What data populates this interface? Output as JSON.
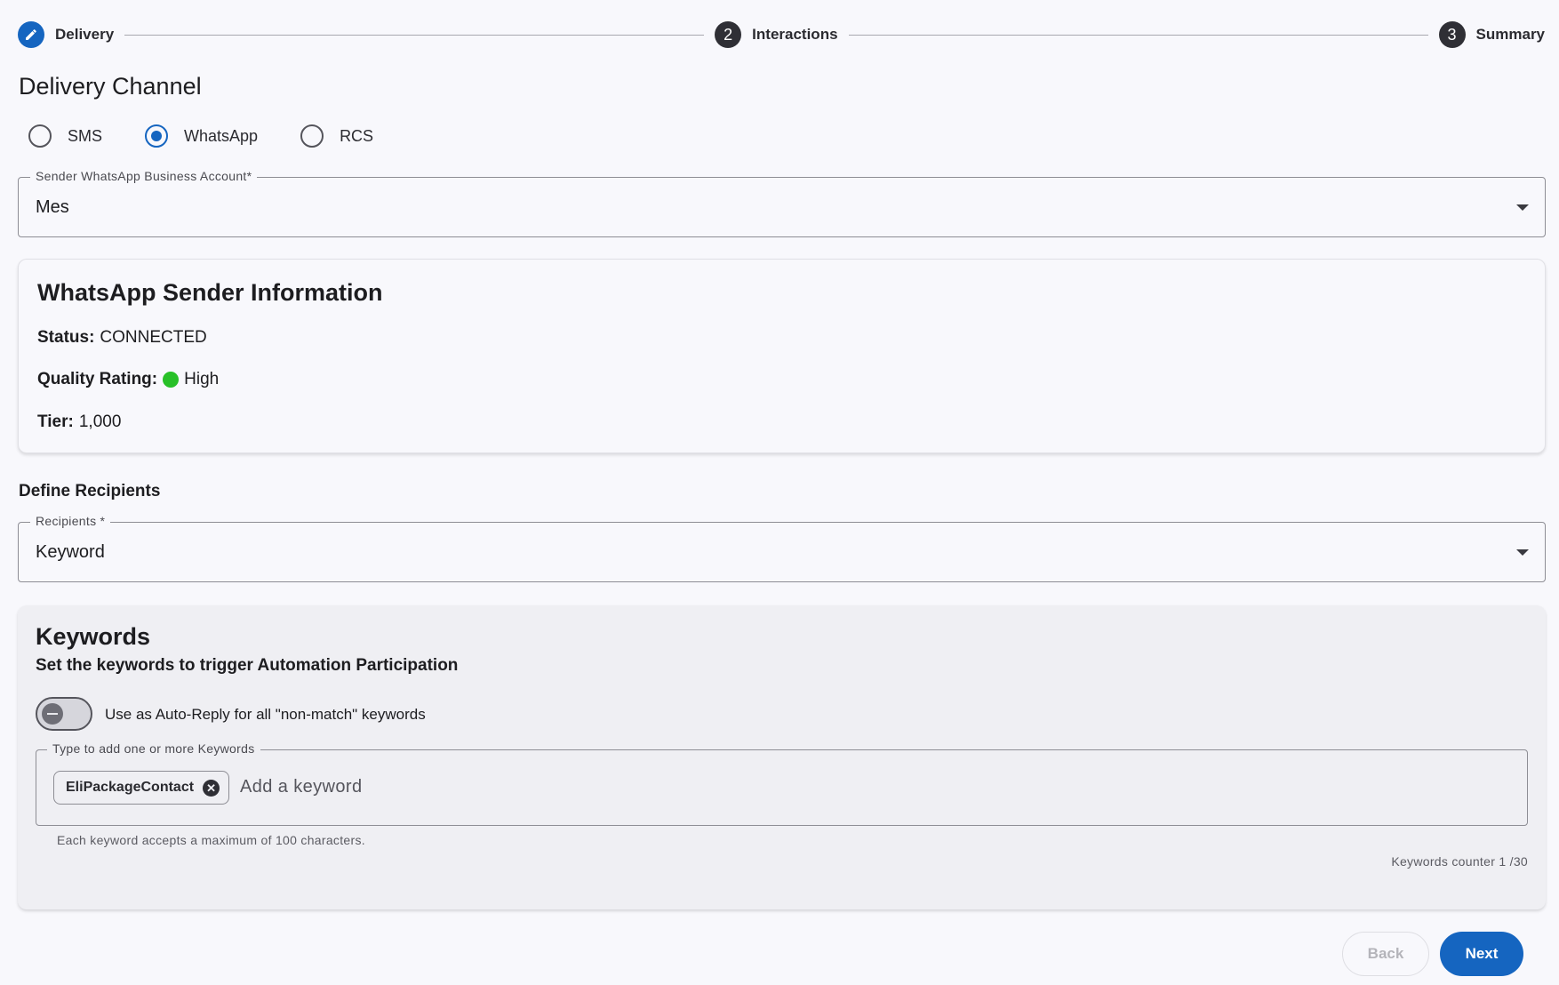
{
  "stepper": {
    "steps": [
      {
        "label": "Delivery",
        "marker": "pencil-icon"
      },
      {
        "label": "Interactions",
        "number": "2"
      },
      {
        "label": "Summary",
        "number": "3"
      }
    ]
  },
  "delivery": {
    "title": "Delivery Channel",
    "channels": [
      {
        "label": "SMS",
        "checked": false
      },
      {
        "label": "WhatsApp",
        "checked": true
      },
      {
        "label": "RCS",
        "checked": false
      }
    ],
    "account_field": {
      "label": "Sender WhatsApp Business Account*",
      "value": "Mes"
    }
  },
  "sender_info": {
    "title": "WhatsApp Sender Information",
    "status_label": "Status:",
    "status_value": "CONNECTED",
    "quality_label": "Quality Rating:",
    "quality_value": "High",
    "quality_color": "#28c028",
    "tier_label": "Tier:",
    "tier_value": "1,000"
  },
  "recipients": {
    "heading": "Define Recipients",
    "field": {
      "label": "Recipients *",
      "value": "Keyword"
    }
  },
  "keywords": {
    "title": "Keywords",
    "subtitle": "Set the keywords to trigger Automation Participation",
    "toggle_label": "Use as Auto-Reply for all \"non-match\" keywords",
    "toggle_on": false,
    "field_label": "Type to add one or more Keywords",
    "chips": [
      "EliPackageContact"
    ],
    "input_placeholder": "Add a keyword",
    "help_text": "Each keyword accepts a maximum of 100 characters.",
    "counter_text": "Keywords counter 1 /30"
  },
  "actions": {
    "back_label": "Back",
    "next_label": "Next"
  },
  "colors": {
    "accent": "#1565c0",
    "background": "#f8f8fc"
  }
}
